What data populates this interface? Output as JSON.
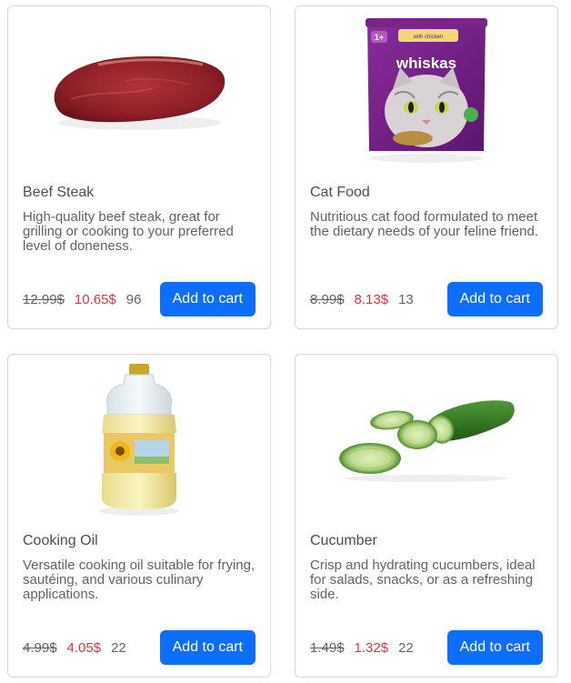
{
  "products": [
    {
      "name": "Beef Steak",
      "description": "High-quality beef steak, great for grilling or cooking to your preferred level of doneness.",
      "old_price": "12.99$",
      "new_price": "10.65$",
      "stock": "96",
      "button_label": "Add to cart",
      "image_icon": "beef-steak-image"
    },
    {
      "name": "Cat Food",
      "description": "Nutritious cat food formulated to meet the dietary needs of your feline friend.",
      "old_price": "8.99$",
      "new_price": "8.13$",
      "stock": "13",
      "button_label": "Add to cart",
      "image_icon": "cat-food-pouch-image",
      "image_text": {
        "brand": "whiskas",
        "badge": "1+",
        "flavor": "with chicken"
      }
    },
    {
      "name": "Cooking Oil",
      "description": "Versatile cooking oil suitable for frying, sautéing, and various culinary applications.",
      "old_price": "4.99$",
      "new_price": "4.05$",
      "stock": "22",
      "button_label": "Add to cart",
      "image_icon": "cooking-oil-bottle-image"
    },
    {
      "name": "Cucumber",
      "description": "Crisp and hydrating cucumbers, ideal for salads, snacks, or as a refreshing side.",
      "old_price": "1.49$",
      "new_price": "1.32$",
      "stock": "22",
      "button_label": "Add to cart",
      "image_icon": "cucumber-image"
    }
  ],
  "colors": {
    "button": "#0d6efd",
    "sale_price": "#dc3545",
    "muted_text": "#5e646a",
    "border": "#d7d7d7"
  }
}
